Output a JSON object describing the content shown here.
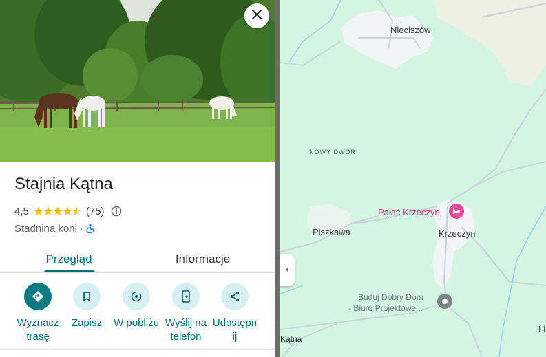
{
  "place": {
    "name": "Stajnia Kątna",
    "rating": "4,5",
    "stars_value": 4.5,
    "stars_max": 5,
    "review_count": "(75)",
    "category": "Stadnina koni",
    "separator": "·"
  },
  "tabs": [
    {
      "label": "Przegląd",
      "active": true
    },
    {
      "label": "Informacje",
      "active": false
    }
  ],
  "actions": [
    {
      "label_line1": "Wyznacz",
      "label_line2": "trasę",
      "icon": "directions-icon"
    },
    {
      "label_line1": "Zapisz",
      "label_line2": "",
      "icon": "bookmark-icon"
    },
    {
      "label_line1": "W pobliżu",
      "label_line2": "",
      "icon": "nearby-icon"
    },
    {
      "label_line1": "Wyślij na",
      "label_line2": "telefon",
      "icon": "send-to-phone-icon"
    },
    {
      "label_line1": "Udostępn",
      "label_line2": "ij",
      "icon": "share-icon"
    }
  ],
  "map": {
    "labels": {
      "nieciszow": "Nieciszów",
      "nowy_dwor": "NOWY DWÓR",
      "palac": "Pałac Krzeczyn",
      "piszkawa": "Piszkawa",
      "krzeczyn": "Krzeczyn",
      "buduj_line1": "Buduj Dobry Dom",
      "buduj_line2": "- Biuro Projektowe...",
      "katna": "Kątna",
      "li": "Li"
    }
  },
  "colors": {
    "accent": "#00707a",
    "primary_button": "#0b7b84",
    "star": "#fbbc04",
    "poi": "#d33a93",
    "map_bg": "#d3f5e1"
  }
}
